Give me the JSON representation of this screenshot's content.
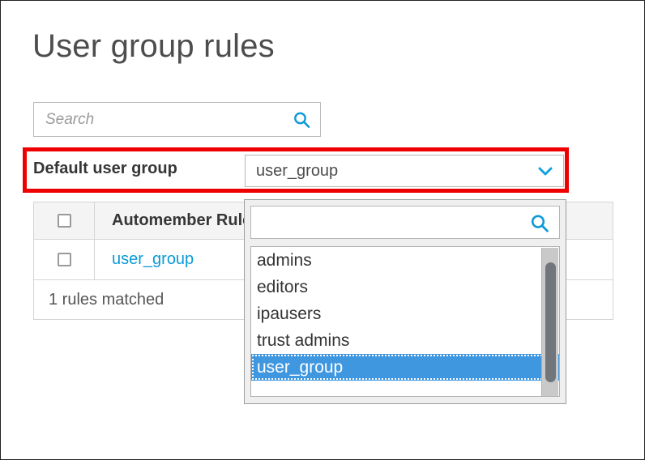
{
  "page": {
    "title": "User group rules"
  },
  "search": {
    "placeholder": "Search",
    "value": "",
    "icon": "search-icon"
  },
  "default_group": {
    "label": "Default user group",
    "select": {
      "value": "user_group",
      "chevron_icon": "chevron-down-icon",
      "expanded": true,
      "filter": {
        "value": "",
        "placeholder": "",
        "icon": "search-icon"
      },
      "options": [
        {
          "label": "admins",
          "selected": false
        },
        {
          "label": "editors",
          "selected": false
        },
        {
          "label": "ipausers",
          "selected": false
        },
        {
          "label": "trust admins",
          "selected": false
        },
        {
          "label": "user_group",
          "selected": true
        }
      ]
    }
  },
  "table": {
    "columns": [
      "",
      "Automember Rule"
    ],
    "header_checkbox_checked": false,
    "rows": [
      {
        "checked": false,
        "name": "user_group"
      }
    ],
    "footer": "1 rules matched"
  },
  "highlight": {
    "name": "red-annotation-box",
    "color": "#ee0000"
  },
  "colors": {
    "accent_blue": "#0a9bd7",
    "selection_blue": "#3f97e0",
    "annotation_red": "#ee0000",
    "text_dark": "#363636",
    "text_muted": "#9b9b9b"
  }
}
